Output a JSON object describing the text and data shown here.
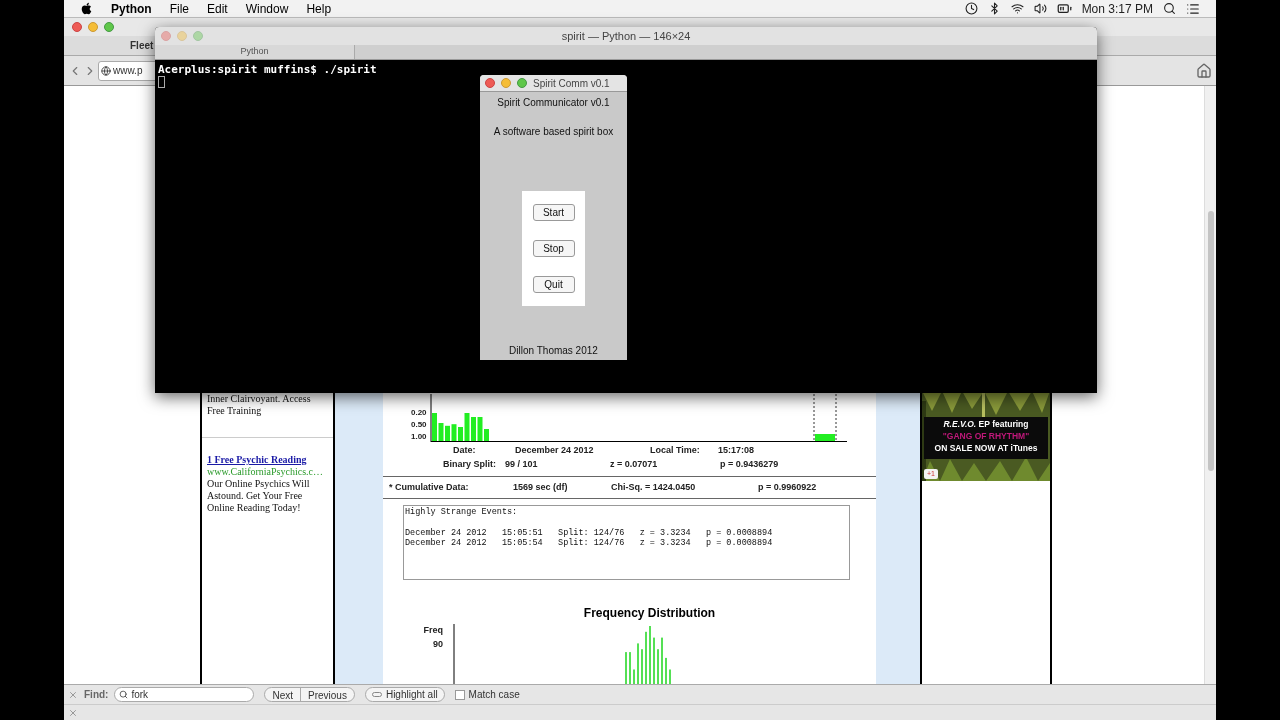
{
  "menu_bar": {
    "app": "Python",
    "menus": [
      "File",
      "Edit",
      "Window",
      "Help"
    ],
    "clock": "Mon 3:17 PM"
  },
  "browser": {
    "tab": "Fleet",
    "url": "www.p",
    "left_ad": {
      "text_top": "Inner Clairvoyant. Access Free Training",
      "title": "1 Free Psychic Reading",
      "url": "www.CaliforniaPsychics.c…",
      "body": "Our Online Psychics Will Astound. Get Your Free Online Reading Today!"
    },
    "graph": {
      "yticks": [
        "0.20",
        "0.50",
        "1.00"
      ]
    },
    "stats": {
      "date_label": "Date:",
      "date": "December 24 2012",
      "time_label": "Local Time:",
      "time": "15:17:08",
      "split_label": "Binary Split:",
      "split": "99 / 101",
      "z": "z = 0.07071",
      "p": "p = 0.9436279"
    },
    "cumulative": {
      "label": "* Cumulative Data:",
      "df": "1569 sec (df)",
      "chi": "Chi-Sq. = 1424.0450",
      "p": "p = 0.9960922"
    },
    "events": {
      "heading": "Highly Strange Events:",
      "rows": [
        "December 24 2012   15:05:51   Split: 124/76   z = 3.3234   p = 0.0008894",
        "December 24 2012   15:05:54   Split: 124/76   z = 3.3234   p = 0.0008894"
      ]
    },
    "frequency": {
      "title": "Frequency Distribution",
      "ylabel": "Freq",
      "ytick": "90"
    },
    "right_ad": {
      "lines": [
        {
          "text": "*R.E.V.O.* EP featuring",
          "color": "#ffffff"
        },
        {
          "text": "\"GANG OF RHYTHM\"",
          "color": "#c0187a"
        },
        {
          "text": "ON SALE NOW AT iTunes",
          "color": "#ffffff"
        }
      ],
      "plus": "+1"
    },
    "find_bar": {
      "label": "Find:",
      "query": "fork",
      "buttons": [
        "Next",
        "Previous"
      ],
      "highlight": "Highlight all",
      "match_case": {
        "label": "Match case",
        "checked": false
      }
    }
  },
  "terminal": {
    "title": "spirit — Python — 146×24",
    "tab": "Python",
    "lines": [
      "Acerplus:spirit muffins$ ./spirit"
    ]
  },
  "spirit_window": {
    "title": "Spirit Comm v0.1",
    "heading": "Spirit Communicator v0.1",
    "subtitle": "A software based spirit box",
    "buttons": [
      "Start",
      "Stop",
      "Quit"
    ],
    "footer": "Dillon Thomas 2012"
  }
}
